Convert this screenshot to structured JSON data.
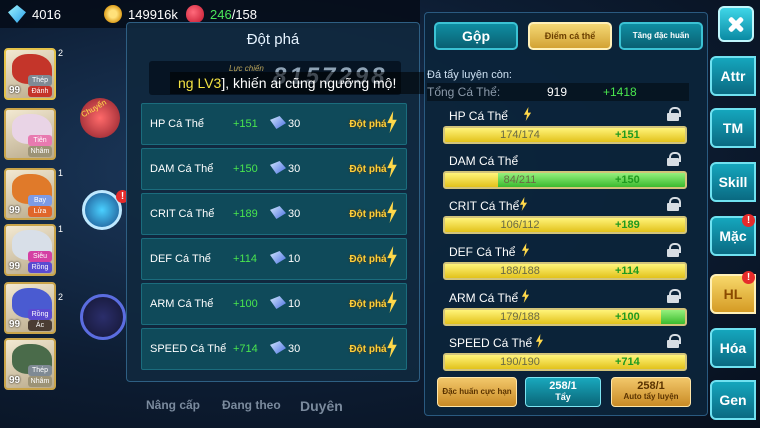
{
  "resources": {
    "diamonds": "4016",
    "gold": "149916k",
    "apples_current": "246",
    "apples_sep": "/158"
  },
  "team": [
    {
      "lv": "99",
      "types": [
        "Thép",
        "Đánh"
      ],
      "side": "2"
    },
    {
      "lv": "",
      "types": [
        "Tiên",
        "Nhâm"
      ],
      "side": ""
    },
    {
      "lv": "99",
      "types": [
        "Bay",
        "Lửa"
      ],
      "side": "1"
    },
    {
      "lv": "99",
      "types": [
        "Siêu",
        "Rồng"
      ],
      "side": "1"
    },
    {
      "lv": "99",
      "types": [
        "Rồng",
        "Ác"
      ],
      "side": "2"
    },
    {
      "lv": "99",
      "types": [
        "Thép",
        "Nhâm"
      ],
      "side": ""
    }
  ],
  "background": {
    "chuyen_label": "Chuyển",
    "bottom_labels": [
      "Nâng cấp",
      "Đang theo",
      "Duyên"
    ]
  },
  "marquee": {
    "prefix": "ng LV3",
    "suffix": "], khiến ai cũng ngưỡng mộ!"
  },
  "breakthrough": {
    "title": "Đột phá",
    "power_label": "Lực chiến",
    "power_value": "8157298",
    "rows": [
      {
        "name": "HP Cá Thể",
        "bonus": "+151",
        "cost": "30",
        "button": "Đột phá"
      },
      {
        "name": "DAM Cá Thể",
        "bonus": "+150",
        "cost": "30",
        "button": "Đột phá"
      },
      {
        "name": "CRIT Cá Thể",
        "bonus": "+189",
        "cost": "30",
        "button": "Đột phá"
      },
      {
        "name": "DEF Cá Thể",
        "bonus": "+114",
        "cost": "10",
        "button": "Đột phá"
      },
      {
        "name": "ARM Cá Thể",
        "bonus": "+100",
        "cost": "10",
        "button": "Đột phá"
      },
      {
        "name": "SPEED Cá Thể",
        "bonus": "+714",
        "cost": "30",
        "button": "Đột phá"
      }
    ]
  },
  "stats": {
    "tabs": [
      "Gộp",
      "Điểm cá thể",
      "Tăng đặc huấn"
    ],
    "remaining_label": "Đá tẩy luyện còn:",
    "total_label": "Tổng Cá Thể:",
    "total_value": "919",
    "total_bonus": "+1418",
    "rows": [
      {
        "name": "HP Cá Thể",
        "value": "174/174",
        "bonus": "+151",
        "fill": 1.0,
        "extra": 0.0
      },
      {
        "name": "DAM Cá Thể",
        "value": "84/211",
        "bonus": "+150",
        "fill": 0.22,
        "extra": 0.78
      },
      {
        "name": "CRIT Cá Thể",
        "value": "106/112",
        "bonus": "+189",
        "fill": 1.0,
        "extra": 0.0
      },
      {
        "name": "DEF Cá Thể",
        "value": "188/188",
        "bonus": "+114",
        "fill": 1.0,
        "extra": 0.0
      },
      {
        "name": "ARM Cá Thể",
        "value": "179/188",
        "bonus": "+100",
        "fill": 0.9,
        "extra": 0.1
      },
      {
        "name": "SPEED Cá Thể",
        "value": "190/190",
        "bonus": "+714",
        "fill": 1.0,
        "extra": 0.0
      }
    ],
    "buttons": {
      "special": "Đặc huấn cực hạn",
      "wash_count": "258/1",
      "wash_label": "Tẩy",
      "auto_count": "258/1",
      "auto_label": "Auto tẩy luyện"
    }
  },
  "nav": {
    "items": [
      "Attr",
      "TM",
      "Skill",
      "Mặc",
      "HL",
      "Hóa",
      "Gen"
    ],
    "badge": "!"
  },
  "colors": {
    "accent_teal": "#0f8ea2",
    "gold": "#d3a233",
    "bonus_green": "#49e64e"
  }
}
